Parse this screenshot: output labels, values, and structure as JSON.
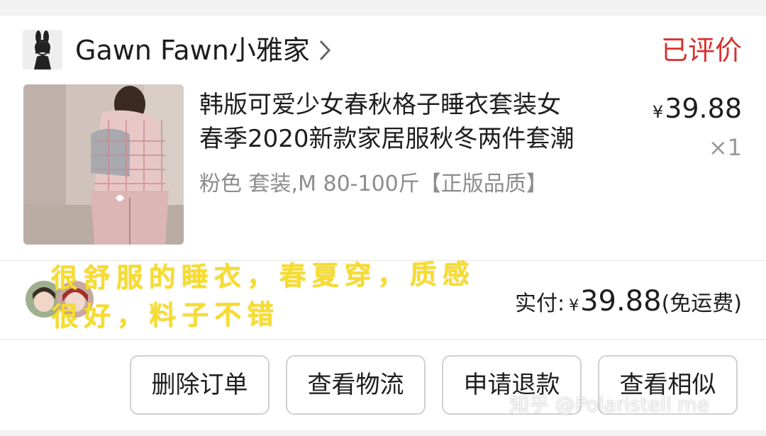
{
  "shop": {
    "name": "Gawn Fawn小雅家",
    "avatar_icon": "bunny-girl-logo-icon",
    "chevron_icon": "chevron-right-icon"
  },
  "order": {
    "status": "已评价",
    "status_color": "#d8312f"
  },
  "product": {
    "title_line1": "韩版可爱少女春秋格子睡衣套装女",
    "title_line2": "春季2020新款家居服秋冬两件套潮",
    "sku": "粉色 套装,M 80-100斤【正版品质】",
    "currency": "¥",
    "price": "39.88",
    "quantity": "×1",
    "image_icon": "pajama-photo"
  },
  "payment": {
    "label": "实付:",
    "currency": "¥",
    "amount": "39.88",
    "shipping_note": "(免运费)"
  },
  "annotation": {
    "line1": "很舒服的睡衣，春夏穿，质感",
    "line2": "很好，料子不错",
    "color": "#f6dc2d"
  },
  "buttons": {
    "delete": "删除订单",
    "logistics": "查看物流",
    "refund": "申请退款",
    "similar": "查看相似"
  },
  "watermark": "知乎 @Polaristell me"
}
